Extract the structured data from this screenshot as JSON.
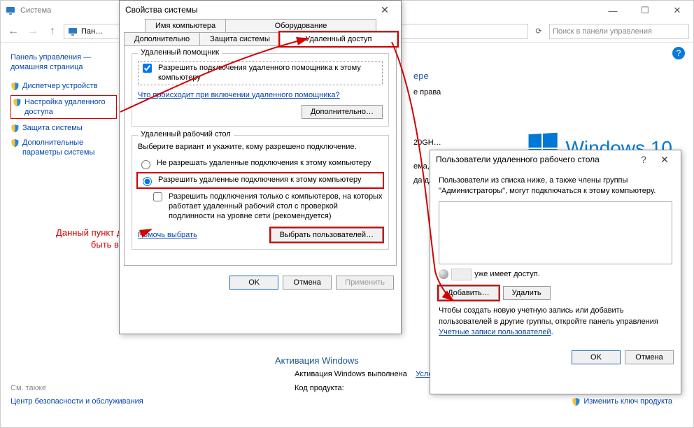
{
  "main": {
    "title": "Система",
    "breadcrumb": "Пан…",
    "search_placeholder": "Поиск в панели управления",
    "sidebar": {
      "home": "Панель управления — домашняя страница",
      "links": [
        "Диспетчер устройств",
        "Настройка удаленного доступа",
        "Защита системы",
        "Дополнительные параметры системы"
      ],
      "related_title": "См. также",
      "related_link": "Центр безопасности и обслуживания"
    },
    "section1_title": "ере",
    "section_rights": "е права",
    "proc_label": "20GH…",
    "mem_label": "ема, п…",
    "pen_label": "да для…",
    "activation_section": "Активация Windows",
    "activation_status": "Активация Windows выполнена",
    "license_link": "Условия лицензионного соглаш… Майкрософт",
    "product_key_label": "Код продукта:",
    "change_key": "Изменить ключ продукта",
    "win10_text": "Windows 10"
  },
  "annotation": "Данный пункт должен быть выбран!",
  "dlg_props": {
    "title": "Свойства системы",
    "tabs_row1": [
      "Имя компьютера",
      "Оборудование"
    ],
    "tabs_row2": [
      "Дополнительно",
      "Защита системы",
      "Удаленный доступ"
    ],
    "group1_title": "Удаленный помощник",
    "chk_ra": "Разрешить подключения удаленного помощника к этому компьютеру",
    "ra_link": "Что происходит при включении удаленного помощника?",
    "advanced_btn": "Дополнительно…",
    "group2_title": "Удаленный рабочий стол",
    "rd_desc": "Выберите вариант и укажите, кому разрешено подключение.",
    "radio1": "Не разрешать удаленные подключения к этому компьютеру",
    "radio2": "Разрешить удаленные подключения к этому компьютеру",
    "chk_nla": "Разрешить подключения только с компьютеров, на которых работает удаленный рабочий стол с проверкой подлинности на уровне сети (рекомендуется)",
    "help_link": "Помочь выбрать",
    "select_users_btn": "Выбрать пользователей…",
    "ok": "OK",
    "cancel": "Отмена",
    "apply": "Применить"
  },
  "dlg_users": {
    "title": "Пользователи удаленного рабочего стола",
    "desc": "Пользователи из списка ниже, а также члены группы \"Администраторы\", могут подключаться к этому компьютеру.",
    "access_suffix": "уже имеет доступ.",
    "add_btn": "Добавить…",
    "remove_btn": "Удалить",
    "hint1": "Чтобы создать новую учетную запись или добавить пользователей в другие группы, откройте панель управления ",
    "hint_link": "Учетные записи пользователей",
    "ok": "OK",
    "cancel": "Отмена"
  }
}
